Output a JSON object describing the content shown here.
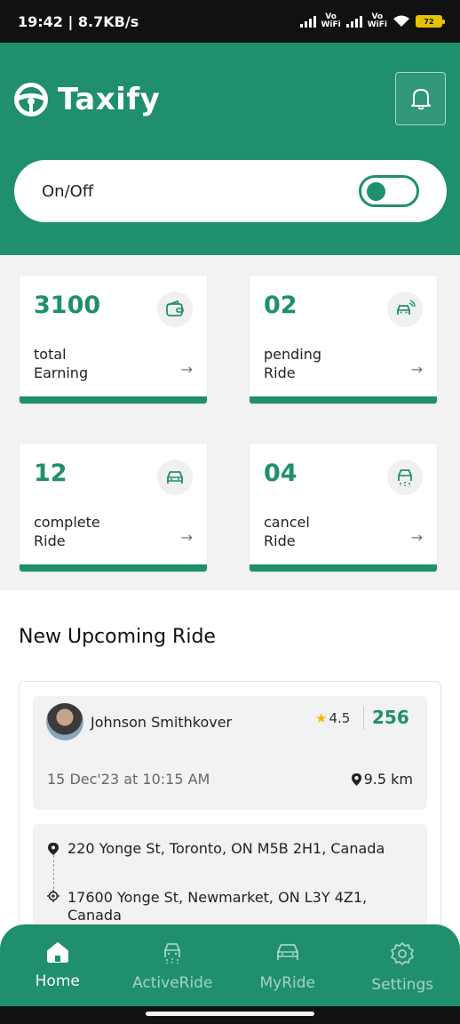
{
  "status_bar": {
    "time_speed": "19:42 | 8.7KB/s",
    "volte1": "Vo\nWiFi",
    "volte2": "Vo\nWiFi",
    "battery": "72"
  },
  "header": {
    "app_name": "Taxify",
    "toggle_label": "On/Off",
    "toggle_on": true
  },
  "stats": [
    {
      "value": "3100",
      "label_line1": "total",
      "label_line2": "Earning",
      "icon": "wallet-icon",
      "arrow": "→"
    },
    {
      "value": "02",
      "label_line1": "pending",
      "label_line2": "Ride",
      "icon": "car-signal-icon",
      "arrow": "→"
    },
    {
      "value": "12",
      "label_line1": "complete",
      "label_line2": "Ride",
      "icon": "car-icon",
      "arrow": "→"
    },
    {
      "value": "04",
      "label_line1": "cancel",
      "label_line2": "Ride",
      "icon": "car-cancel-icon",
      "arrow": "→"
    }
  ],
  "upcoming": {
    "title": "New Upcoming Ride",
    "ride": {
      "rider_name": "Johnson Smithkover",
      "rating": "4.5",
      "fare": "256",
      "datetime": "15 Dec'23 at 10:15 AM",
      "distance": "9.5 km",
      "pickup": "220 Yonge St, Toronto, ON M5B 2H1, Canada",
      "dropoff": "17600 Yonge St, Newmarket, ON L3Y 4Z1, Canada"
    }
  },
  "nav": {
    "items": [
      {
        "label": "Home",
        "icon": "home-icon",
        "active": true
      },
      {
        "label": "ActiveRide",
        "icon": "active-ride-icon",
        "active": false
      },
      {
        "label": "MyRide",
        "icon": "my-ride-icon",
        "active": false
      },
      {
        "label": "Settings",
        "icon": "settings-icon",
        "active": false
      }
    ]
  },
  "colors": {
    "primary": "#1f8f6e",
    "background": "#f2f2f2",
    "star": "#f5b800"
  }
}
